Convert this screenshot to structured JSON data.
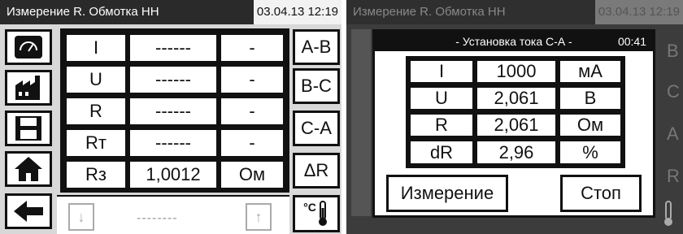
{
  "left_screen": {
    "title": "Измерение R. Обмотка НН",
    "datetime": "03.04.13 12:19",
    "side_icons": [
      "meter-icon",
      "factory-icon",
      "floppy-disk-icon",
      "home-icon",
      "back-arrow-icon"
    ],
    "table": [
      {
        "label": "I",
        "value": "------",
        "unit": "-"
      },
      {
        "label": "U",
        "value": "------",
        "unit": "-"
      },
      {
        "label": "R",
        "value": "------",
        "unit": "-"
      },
      {
        "label": "Rт",
        "value": "------",
        "unit": "-"
      },
      {
        "label": "Rз",
        "value": "1,0012",
        "unit": "Ом"
      }
    ],
    "phase_buttons": [
      "A-B",
      "B-C",
      "C-A",
      "ΔR"
    ],
    "temp_label": "°C",
    "bottom": {
      "down_arrow": "↓",
      "up_arrow": "↑",
      "value": "--------"
    }
  },
  "right_screen": {
    "title": "Измерение R. Обмотка НН",
    "datetime": "03.04.13 12:19",
    "background_buttons": [
      "B",
      "C",
      "A",
      "R"
    ],
    "dialog": {
      "title": "- Установка тока С-А -",
      "timer": "00:41",
      "rows": [
        {
          "label": "I",
          "value": "1000",
          "unit": "мА"
        },
        {
          "label": "U",
          "value": "2,061",
          "unit": "В"
        },
        {
          "label": "R",
          "value": "2,061",
          "unit": "Ом"
        },
        {
          "label": "dR",
          "value": "2,96",
          "unit": "%"
        }
      ],
      "measure_button": "Измерение",
      "stop_button": "Стоп"
    }
  }
}
